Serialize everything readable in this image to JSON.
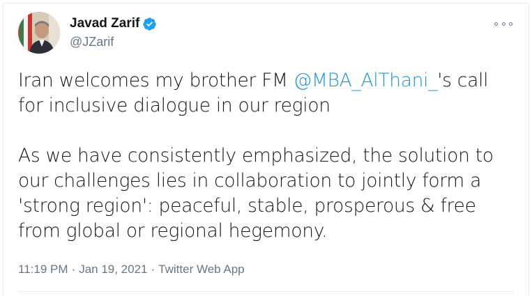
{
  "author": {
    "display_name": "Javad Zarif",
    "handle": "@JZarif",
    "verified": true,
    "avatar_icon": "profile-photo"
  },
  "tweet": {
    "paragraph1": {
      "before": "Iran welcomes my brother FM ",
      "mention": "@MBA_AlThani_",
      "after": "'s call for inclusive dialogue in our region"
    },
    "paragraph2": "As we have consistently emphasized, the solution to our challenges lies in collaboration to jointly form a 'strong region': peaceful, stable, prosperous & free from global or regional hegemony."
  },
  "meta": {
    "time": "11:19 PM",
    "date": "Jan 19, 2021",
    "source": "Twitter Web App",
    "separator": "·"
  },
  "colors": {
    "text": "#14171a",
    "secondary": "#657786",
    "link": "#1b95e0",
    "verified": "#1da1f2"
  },
  "icons": {
    "more": "more-options-icon",
    "verified": "verified-badge-icon"
  }
}
